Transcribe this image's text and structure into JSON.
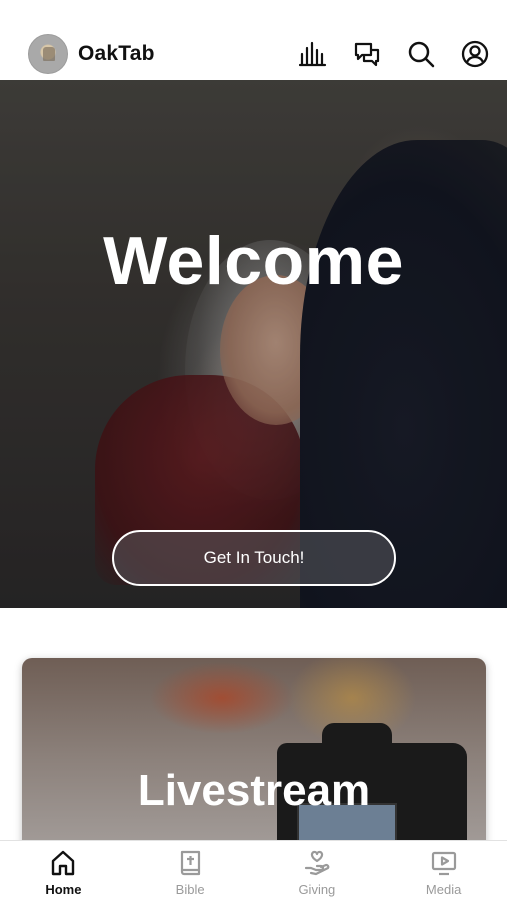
{
  "header": {
    "app_name": "OakTab",
    "icons": [
      "audio-bars-icon",
      "chat-icon",
      "search-icon",
      "account-icon"
    ]
  },
  "hero": {
    "title": "Welcome",
    "cta_label": "Get In Touch!",
    "slides_total": 3,
    "active_slide": 1
  },
  "livestream": {
    "title": "Livestream"
  },
  "bottom_nav": {
    "items": [
      {
        "label": "Home",
        "icon": "home-icon",
        "active": true
      },
      {
        "label": "Bible",
        "icon": "bible-icon",
        "active": false
      },
      {
        "label": "Giving",
        "icon": "giving-icon",
        "active": false
      },
      {
        "label": "Media",
        "icon": "media-icon",
        "active": false
      }
    ]
  },
  "colors": {
    "active_tab": "#111111",
    "inactive_tab": "#9a9a9a",
    "hero_button_border": "#ffffff"
  }
}
